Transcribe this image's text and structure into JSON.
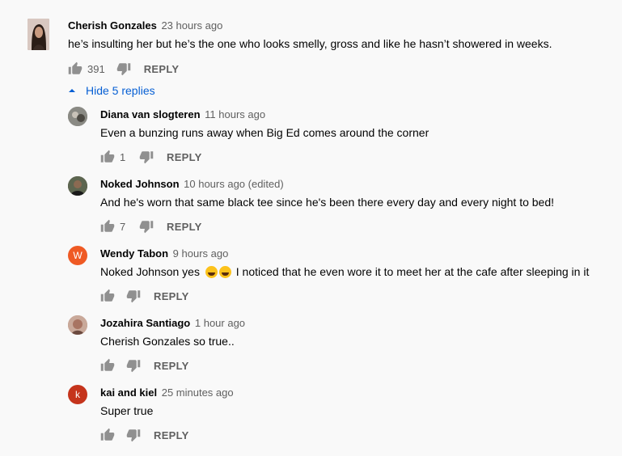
{
  "top_comment": {
    "author": "Cherish Gonzales",
    "time": "23 hours ago",
    "text": "he’s insulting her but he’s the one who looks smelly, gross and like he hasn’t showered in weeks.",
    "likes": "391",
    "reply_label": "REPLY",
    "avatar_icon": "profile-photo"
  },
  "replies_toggle": {
    "label": "Hide 5 replies",
    "icon": "caret-up-icon",
    "color": "#065fd4"
  },
  "replies": [
    {
      "author": "Diana van slogteren",
      "time": "11 hours ago",
      "text": "Even a bunzing runs away when Big Ed comes around the corner",
      "likes": "1",
      "reply_label": "REPLY",
      "avatar_color": "#7a7a7a"
    },
    {
      "author": "Noked Johnson",
      "time": "10 hours ago (edited)",
      "text": "And he's worn that same black tee since he's been there every day and every night to bed!",
      "likes": "7",
      "reply_label": "REPLY",
      "avatar_color": "#3d3428"
    },
    {
      "author": "Wendy Tabon",
      "time": "9 hours ago",
      "text_before": "Noked Johnson yes",
      "text_after": " I noticed that he even wore it to meet her at the cafe after sleeping in it",
      "emoji": "😂😂",
      "likes": "",
      "reply_label": "REPLY",
      "avatar_letter": "W",
      "avatar_color": "#ef5a24"
    },
    {
      "author": "Jozahira Santiago",
      "time": "1 hour ago",
      "text": "Cherish Gonzales so true..",
      "likes": "",
      "reply_label": "REPLY",
      "avatar_color": "#b98a78"
    },
    {
      "author": "kai and kiel",
      "time": "25 minutes ago",
      "text": "Super true",
      "likes": "",
      "reply_label": "REPLY",
      "avatar_letter": "k",
      "avatar_color": "#c5341c"
    }
  ]
}
